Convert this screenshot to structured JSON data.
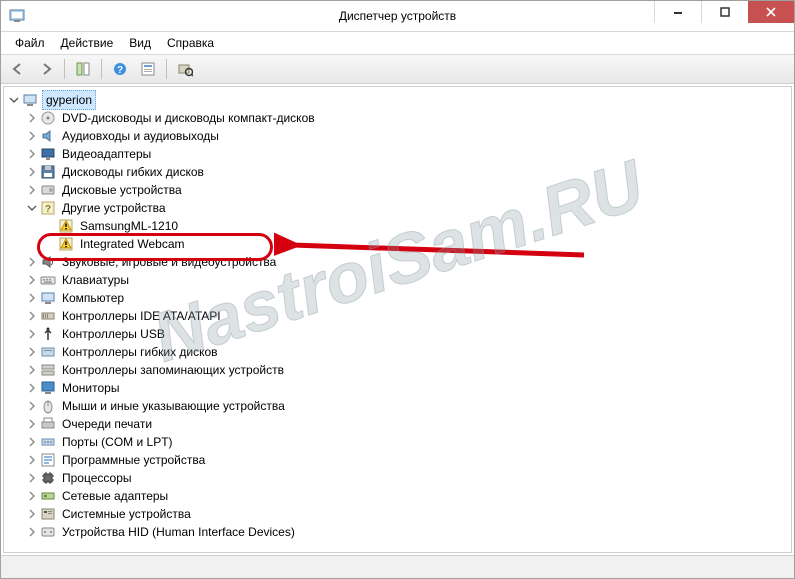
{
  "window": {
    "title": "Диспетчер устройств"
  },
  "menu": {
    "file": "Файл",
    "action": "Действие",
    "view": "Вид",
    "help": "Справка"
  },
  "tree": {
    "root": "gyperion",
    "items": [
      {
        "label": "DVD-дисководы и дисководы компакт-дисков",
        "icon": "disc"
      },
      {
        "label": "Аудиовходы и аудиовыходы",
        "icon": "audio"
      },
      {
        "label": "Видеоадаптеры",
        "icon": "display"
      },
      {
        "label": "Дисководы гибких дисков",
        "icon": "floppy"
      },
      {
        "label": "Дисковые устройства",
        "icon": "hdd"
      },
      {
        "label": "Другие устройства",
        "icon": "unknown",
        "expanded": true,
        "children": [
          {
            "label": "SamsungML-1210",
            "icon": "warn"
          },
          {
            "label": "Integrated Webcam",
            "icon": "warn",
            "highlighted": true
          }
        ]
      },
      {
        "label": "Звуковые, игровые и видеоустройства",
        "icon": "sound"
      },
      {
        "label": "Клавиатуры",
        "icon": "keyboard"
      },
      {
        "label": "Компьютер",
        "icon": "computer"
      },
      {
        "label": "Контроллеры IDE ATA/ATAPI",
        "icon": "ide"
      },
      {
        "label": "Контроллеры USB",
        "icon": "usb"
      },
      {
        "label": "Контроллеры гибких дисков",
        "icon": "floppyctrl"
      },
      {
        "label": "Контроллеры запоминающих устройств",
        "icon": "storage"
      },
      {
        "label": "Мониторы",
        "icon": "monitor"
      },
      {
        "label": "Мыши и иные указывающие устройства",
        "icon": "mouse"
      },
      {
        "label": "Очереди печати",
        "icon": "printer"
      },
      {
        "label": "Порты (COM и LPT)",
        "icon": "port"
      },
      {
        "label": "Программные устройства",
        "icon": "soft"
      },
      {
        "label": "Процессоры",
        "icon": "cpu"
      },
      {
        "label": "Сетевые адаптеры",
        "icon": "net"
      },
      {
        "label": "Системные устройства",
        "icon": "system"
      },
      {
        "label": "Устройства HID (Human Interface Devices)",
        "icon": "hid"
      }
    ]
  },
  "watermark": "NastroiSam.RU"
}
